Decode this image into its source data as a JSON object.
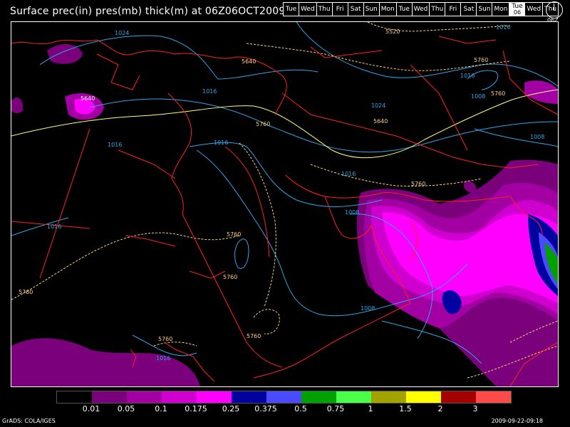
{
  "title": "Surface prec(in) pres(mb) thick(m) at 06Z06OCT2009",
  "days": [
    "Tue",
    "Wed",
    "Thu",
    "Fri",
    "Sat",
    "Sun",
    "Mon",
    "Tue",
    "Wed",
    "Thu",
    "Fri",
    "Sat",
    "Sun",
    "Mon",
    "Tue",
    "Wed",
    "Thu"
  ],
  "active_day_index": 14,
  "active_day_sub": "06",
  "clock_label": "06Z",
  "legend": {
    "colors": [
      "#000000",
      "#7b007b",
      "#a300a3",
      "#cf00cf",
      "#ff00ff",
      "#0000a0",
      "#4a4aff",
      "#00a000",
      "#4aff4a",
      "#a3a300",
      "#ffff00",
      "#a30000",
      "#ff4a4a"
    ],
    "labels": [
      "0.01",
      "0.05",
      "0.1",
      "0.175",
      "0.25",
      "0.375",
      "0.5",
      "0.75",
      "1",
      "1.5",
      "2",
      "3"
    ]
  },
  "contour_labels": {
    "pressure": [
      "1024",
      "1016",
      "1016",
      "1016",
      "1024",
      "1016",
      "1008",
      "1008",
      "1008",
      "1016",
      "1016",
      "1016",
      "1008",
      "1016"
    ],
    "thickness": [
      "5520",
      "5640",
      "5640",
      "5640",
      "5760",
      "5760",
      "5760",
      "5760",
      "5760",
      "5760",
      "5760",
      "5760",
      "5760"
    ]
  },
  "footer_left": "GrADS: COLA/IGES",
  "footer_right": "2009-09-22-09:18"
}
